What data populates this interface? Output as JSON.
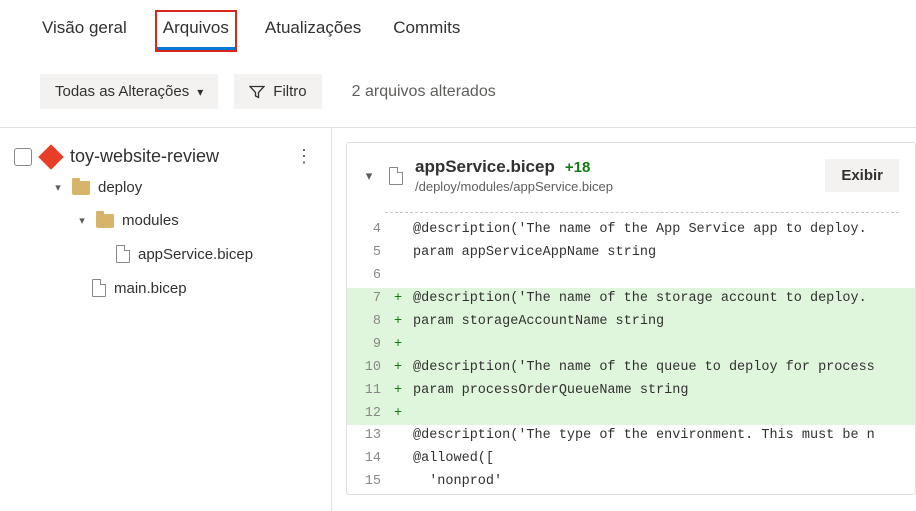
{
  "tabs": {
    "overview": "Visão geral",
    "files": "Arquivos",
    "updates": "Atualizações",
    "commits": "Commits"
  },
  "toolbar": {
    "changes_label": "Todas as Alterações",
    "filter_label": "Filtro",
    "summary": "2 arquivos alterados"
  },
  "tree": {
    "repo": "toy-website-review",
    "deploy": "deploy",
    "modules": "modules",
    "appservice": "appService.bicep",
    "main": "main.bicep"
  },
  "diff": {
    "filename": "appService.bicep",
    "added": "+18",
    "path": "/deploy/modules/appService.bicep",
    "view_label": "Exibir",
    "lines": [
      {
        "n": 4,
        "add": false,
        "text": "@description('The name of the App Service app to deploy."
      },
      {
        "n": 5,
        "add": false,
        "text": "param appServiceAppName string"
      },
      {
        "n": 6,
        "add": false,
        "text": ""
      },
      {
        "n": 7,
        "add": true,
        "text": "@description('The name of the storage account to deploy."
      },
      {
        "n": 8,
        "add": true,
        "text": "param storageAccountName string"
      },
      {
        "n": 9,
        "add": true,
        "text": ""
      },
      {
        "n": 10,
        "add": true,
        "text": "@description('The name of the queue to deploy for process"
      },
      {
        "n": 11,
        "add": true,
        "text": "param processOrderQueueName string"
      },
      {
        "n": 12,
        "add": true,
        "text": ""
      },
      {
        "n": 13,
        "add": false,
        "text": "@description('The type of the environment. This must be n"
      },
      {
        "n": 14,
        "add": false,
        "text": "@allowed(["
      },
      {
        "n": 15,
        "add": false,
        "text": "  'nonprod'"
      }
    ]
  }
}
